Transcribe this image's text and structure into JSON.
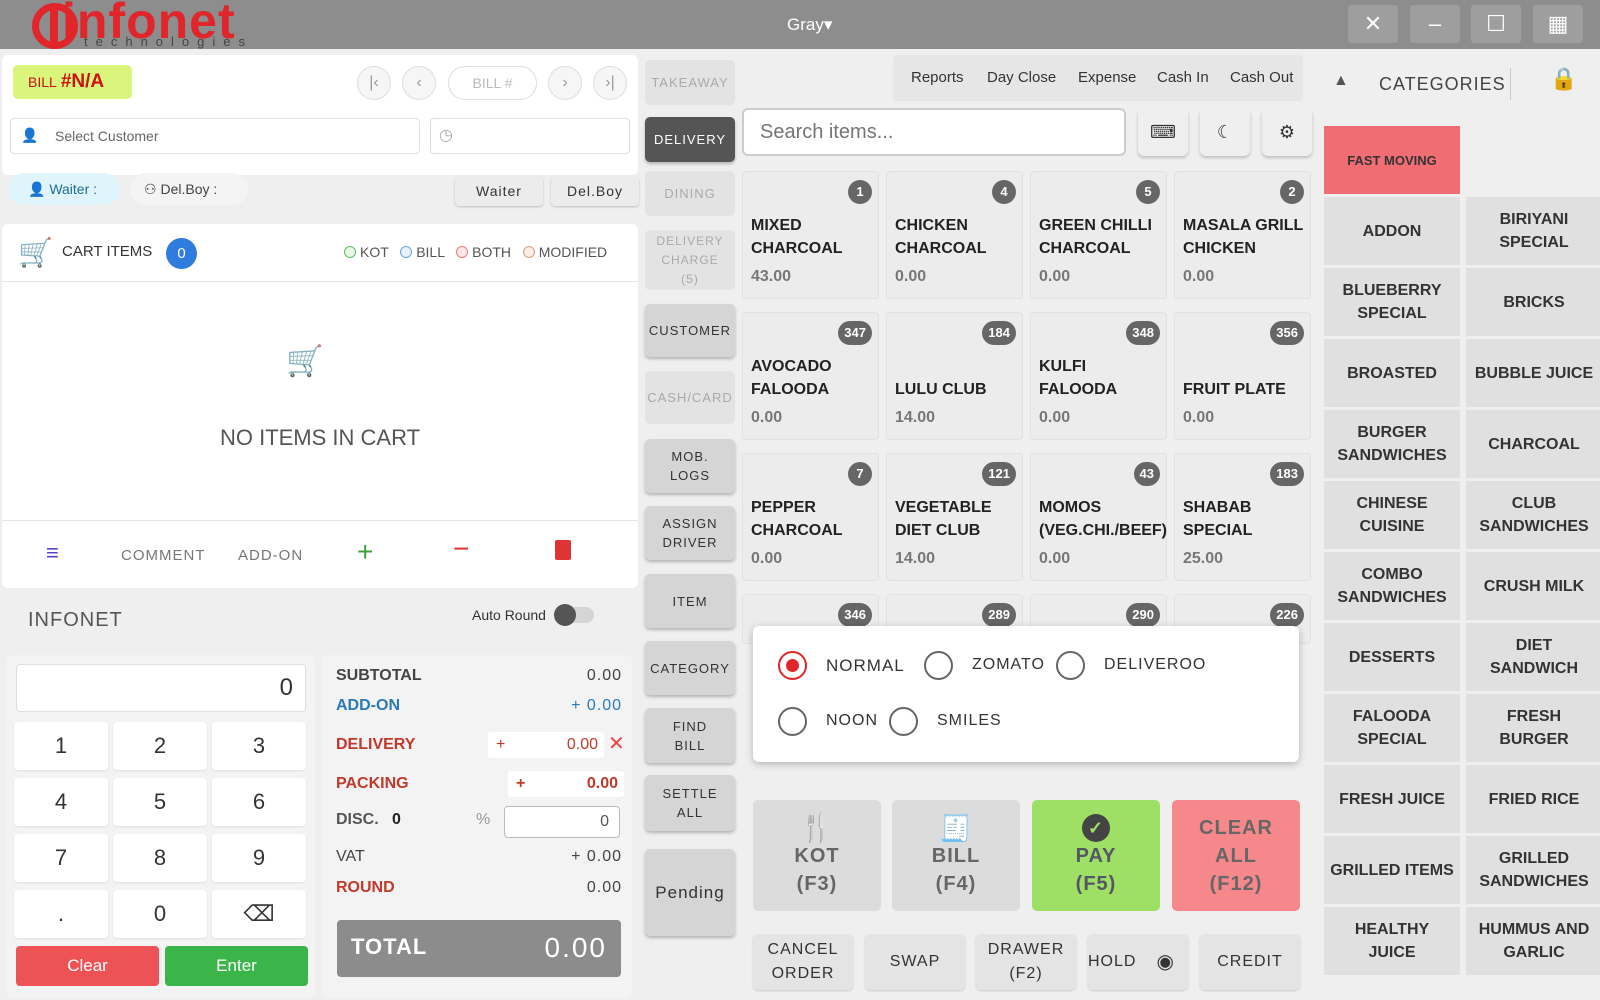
{
  "topbar": {
    "logo": "infonet",
    "logo_sub": "technologies",
    "theme": "Gray▾",
    "buttons": [
      "✕",
      "–",
      "☐",
      "▦"
    ]
  },
  "bill": {
    "prefix": "BILL",
    "number": "#N/A",
    "bill_no_placeholder": "BILL #"
  },
  "customer": {
    "placeholder": "Select Customer"
  },
  "staff": {
    "waiter_label": "Waiter :",
    "delboy_label": "Del.Boy :",
    "waiter_btn": "Waiter",
    "delboy_btn": "Del.Boy"
  },
  "cart": {
    "title": "CART ITEMS",
    "count": "0",
    "legend": [
      "KOT",
      "BILL",
      "BOTH",
      "MODIFIED"
    ],
    "empty": "NO ITEMS IN CART",
    "comment": "COMMENT",
    "addon": "ADD-ON"
  },
  "company": "INFONET",
  "auto_round": "Auto Round",
  "numpad": {
    "display": "0",
    "keys": [
      "1",
      "2",
      "3",
      "4",
      "5",
      "6",
      "7",
      "8",
      "9",
      ".",
      "0"
    ],
    "clear": "Clear",
    "enter": "Enter"
  },
  "summary": {
    "subtotal_label": "SUBTOTAL",
    "subtotal": "0.00",
    "addon_label": "ADD-ON",
    "addon": "+ 0.00",
    "delivery_label": "DELIVERY",
    "delivery": "0.00",
    "packing_label": "PACKING",
    "packing": "0.00",
    "disc_label": "DISC.",
    "disc_value": "0",
    "disc_percent": "0",
    "vat_label": "VAT",
    "vat": "+ 0.00",
    "round_label": "ROUND",
    "round": "0.00",
    "total_label": "TOTAL",
    "total": "0.00"
  },
  "order_types": [
    "TAKEAWAY",
    "DELIVERY",
    "DINING",
    "DELIVERY CHARGE (5)",
    "CUSTOMER",
    "CASH/CARD",
    "MOB. LOGS",
    "ASSIGN DRIVER",
    "ITEM",
    "CATEGORY",
    "FIND BILL",
    "SETTLE ALL",
    "Pending"
  ],
  "menu": [
    "Reports",
    "Day Close",
    "Expense",
    "Cash In",
    "Cash Out"
  ],
  "search": {
    "placeholder": "Search items..."
  },
  "categories_title": "CATEGORIES",
  "items": [
    {
      "name": "MIXED CHARCOAL",
      "price": "43.00",
      "badge": "1"
    },
    {
      "name": "CHICKEN CHARCOAL",
      "price": "0.00",
      "badge": "4"
    },
    {
      "name": "GREEN CHILLI CHARCOAL",
      "price": "0.00",
      "badge": "5"
    },
    {
      "name": "MASALA GRILL CHICKEN",
      "price": "0.00",
      "badge": "2"
    },
    {
      "name": "AVOCADO FALOODA",
      "price": "0.00",
      "badge": "347"
    },
    {
      "name": "LULU CLUB",
      "price": "14.00",
      "badge": "184"
    },
    {
      "name": "KULFI FALOODA",
      "price": "0.00",
      "badge": "348"
    },
    {
      "name": "FRUIT PLATE",
      "price": "0.00",
      "badge": "356"
    },
    {
      "name": "PEPPER CHARCOAL",
      "price": "0.00",
      "badge": "7"
    },
    {
      "name": "VEGETABLE DIET CLUB",
      "price": "14.00",
      "badge": "121"
    },
    {
      "name": "MOMOS (VEG.CHI./BEEF)",
      "price": "0.00",
      "badge": "43"
    },
    {
      "name": "SHABAB SPECIAL",
      "price": "25.00",
      "badge": "183"
    },
    {
      "name": "",
      "price": "",
      "badge": "346"
    },
    {
      "name": "",
      "price": "",
      "badge": "289"
    },
    {
      "name": "",
      "price": "",
      "badge": "290"
    },
    {
      "name": "",
      "price": "",
      "badge": "226"
    }
  ],
  "platforms": {
    "selected": "NORMAL",
    "options": [
      "NORMAL",
      "ZOMATO",
      "DELIVEROO",
      "NOON",
      "SMILES"
    ]
  },
  "actions": {
    "kot": "KOT",
    "kot_key": "(F3)",
    "bill": "BILL",
    "bill_key": "(F4)",
    "pay": "PAY",
    "pay_key": "(F5)",
    "clear": "CLEAR ALL",
    "clear_key": "(F12)"
  },
  "bottom": {
    "cancel": "CANCEL ORDER",
    "swap": "SWAP",
    "drawer": "DRAWER (F2)",
    "hold": "HOLD",
    "credit": "CREDIT"
  },
  "category_list": [
    "FAST MOVING",
    "",
    "ADDON",
    "BIRIYANI SPECIAL",
    "BLUEBERRY SPECIAL",
    "BRICKS",
    "BROASTED",
    "BUBBLE JUICE",
    "BURGER SANDWICHES",
    "CHARCOAL",
    "CHINESE CUISINE",
    "CLUB SANDWICHES",
    "COMBO SANDWICHES",
    "CRUSH MILK",
    "DESSERTS",
    "DIET SANDWICH",
    "FALOODA SPECIAL",
    "FRESH BURGER",
    "FRESH JUICE",
    "FRIED RICE",
    "GRILLED ITEMS",
    "GRILLED SANDWICHES",
    "HEALTHY JUICE",
    "HUMMUS AND GARLIC"
  ],
  "colors": {
    "brand": "#e0262b",
    "pay": "#9ee065",
    "clear": "#f6878a",
    "fast_moving": "#f06e73",
    "bill_badge": "#d9f57c"
  }
}
